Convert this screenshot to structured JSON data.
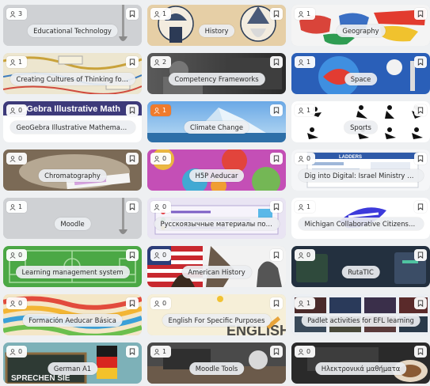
{
  "cards": [
    {
      "title": "Educational Technology",
      "count": "3"
    },
    {
      "title": "History",
      "count": "1"
    },
    {
      "title": "Geography",
      "count": "1"
    },
    {
      "title": "Creating Cultures of Thinking for Schools",
      "count": "1"
    },
    {
      "title": "Competency Frameworks",
      "count": "2"
    },
    {
      "title": "Space",
      "count": "1"
    },
    {
      "title": "GeoGebra Illustrative Mathematics",
      "count": "0",
      "banner": "GeoGebra Illustrative Math"
    },
    {
      "title": "Climate Change",
      "count": "1",
      "highlight": true
    },
    {
      "title": "Sports",
      "count": "1"
    },
    {
      "title": "Chromatography",
      "count": "0"
    },
    {
      "title": "H5P Aeducar",
      "count": "0"
    },
    {
      "title": "Dig into Digital: Israel Ministry of Educ…",
      "count": "0",
      "banner": "LADDERS"
    },
    {
      "title": "Moodle",
      "count": "1"
    },
    {
      "title": "Русскоязычные материалы по ABC …",
      "count": "0"
    },
    {
      "title": "Michigan Collaborative Citizenship Cur…",
      "count": "1"
    },
    {
      "title": "Learning management system",
      "count": "0"
    },
    {
      "title": "American History",
      "count": "0"
    },
    {
      "title": "RutaTIC",
      "count": "0"
    },
    {
      "title": "Formación Aeducar Básica",
      "count": "0"
    },
    {
      "title": "English For Specific Purposes",
      "count": "0",
      "banner": "ENGLISH"
    },
    {
      "title": "Padlet activities for EFL learning",
      "count": "1"
    },
    {
      "title": "German A1",
      "count": "0",
      "banner": "SPRECHEN SIE"
    },
    {
      "title": "Moodle Tools",
      "count": "1"
    },
    {
      "title": "Ηλεκτρονικά μαθήματα",
      "count": "0"
    }
  ],
  "colors": {
    "page_background": "#eef0f2",
    "badge_orange": "#f07b2c"
  },
  "icons": {
    "badge": "person-icon",
    "corner": "bookmark-icon"
  }
}
